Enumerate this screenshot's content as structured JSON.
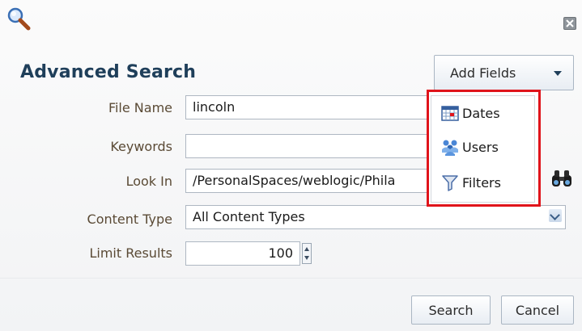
{
  "dialog": {
    "title": "Advanced Search",
    "add_fields_label": "Add Fields",
    "close_icon": "close-icon",
    "search_icon": "magnifier-icon"
  },
  "form": {
    "file_name": {
      "label": "File Name",
      "value": "lincoln"
    },
    "keywords": {
      "label": "Keywords",
      "value": ""
    },
    "look_in": {
      "label": "Look In",
      "value": "/PersonalSpaces/weblogic/Phila",
      "icon": "binoculars-icon"
    },
    "content_type": {
      "label": "Content Type",
      "value": "All Content Types"
    },
    "limit_results": {
      "label": "Limit Results",
      "value": "100"
    }
  },
  "add_fields_menu": {
    "items": [
      {
        "label": "Dates",
        "icon": "calendar-icon"
      },
      {
        "label": "Users",
        "icon": "users-icon"
      },
      {
        "label": "Filters",
        "icon": "filter-icon"
      }
    ]
  },
  "buttons": {
    "search": "Search",
    "cancel": "Cancel"
  },
  "colors": {
    "title": "#1f3f5a",
    "highlight_border": "#e0141b",
    "label": "#5a4a35"
  }
}
